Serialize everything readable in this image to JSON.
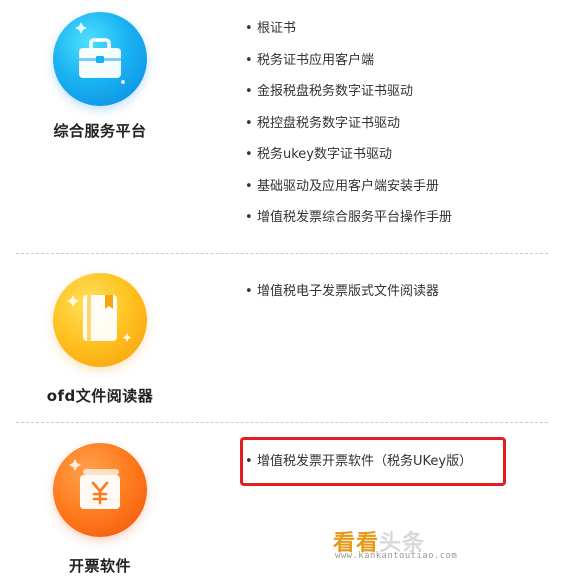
{
  "sections": [
    {
      "title": "综合服务平台",
      "icon": "briefcase-icon",
      "accent": "#1ab3f2",
      "items": [
        "根证书",
        "税务证书应用客户端",
        "金报税盘税务数字证书驱动",
        "税控盘税务数字证书驱动",
        "税务ukey数字证书驱动",
        "基础驱动及应用客户端安装手册",
        "增值税发票综合服务平台操作手册"
      ]
    },
    {
      "title": "ofd文件阅读器",
      "icon": "book-icon",
      "accent": "#ffc01e",
      "items": [
        "增值税电子发票版式文件阅读器"
      ]
    },
    {
      "title": "开票软件",
      "icon": "invoice-yen-icon",
      "accent": "#ff7a1d",
      "items": [
        "增值税发票开票软件（税务UKey版）"
      ]
    }
  ],
  "highlight_color": "#e02020",
  "watermark": {
    "main_a": "看看",
    "main_b": "头条",
    "url": "www.kankantoutiao.com"
  }
}
